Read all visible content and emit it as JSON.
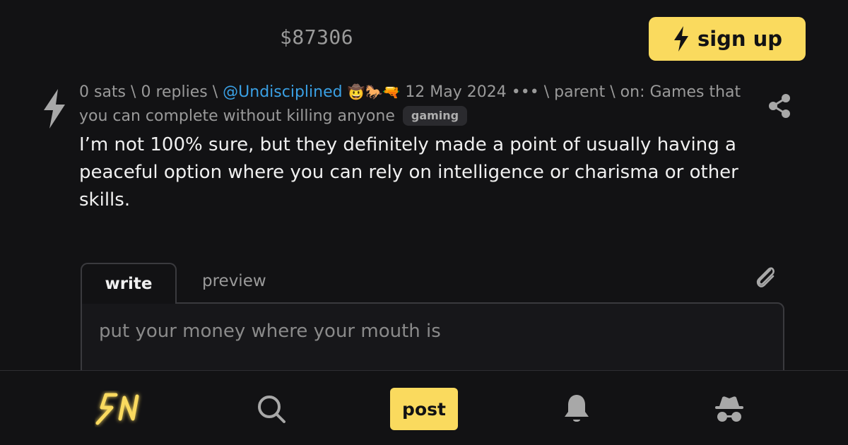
{
  "header": {
    "price": "$87306",
    "signup_label": "sign up"
  },
  "comment": {
    "sats": "0 sats",
    "replies": "0 replies",
    "user": "@Undisciplined",
    "user_emojis": "🤠🐎🔫",
    "date": "12 May 2024",
    "more": "•••",
    "parent": "parent",
    "on_prefix": "on:",
    "thread_title": "Games that you can complete without killing anyone",
    "badge": "gaming",
    "separator": "\\",
    "body": "I’m not 100% sure, but they definitely made a point of usually having a peaceful option where you can rely on intelligence or charisma or other skills."
  },
  "reply_form": {
    "tab_write": "write",
    "tab_preview": "preview",
    "placeholder": "put your money where your mouth is"
  },
  "bottom_nav": {
    "post_label": "post",
    "logo_text": "SN"
  },
  "colors": {
    "accent": "#fada5e",
    "link": "#3aa0e4",
    "background": "#121214",
    "muted": "#9a9a9a"
  }
}
